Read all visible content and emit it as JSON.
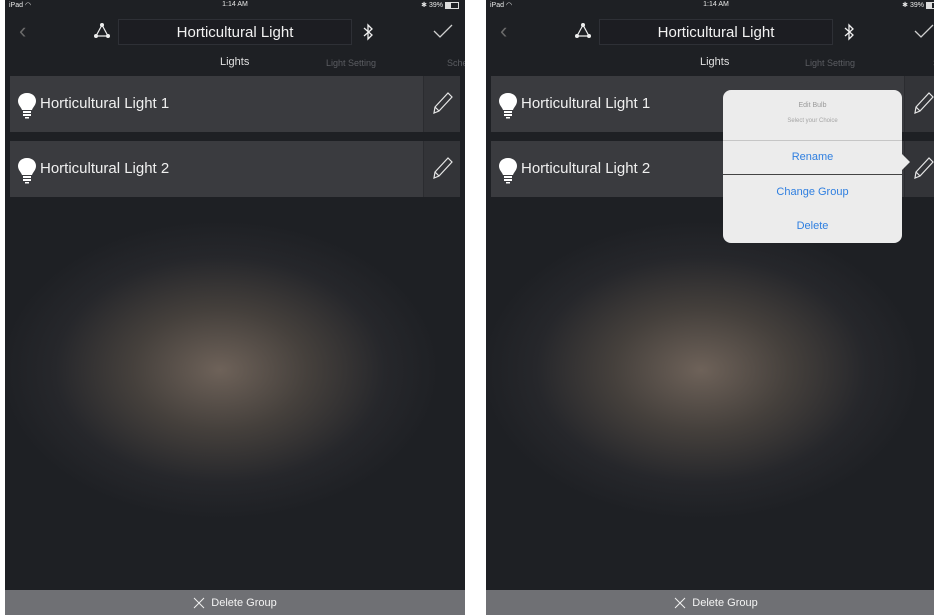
{
  "status": {
    "device": "iPad",
    "time": "1:14 AM",
    "battery": "39%"
  },
  "header": {
    "title": "Horticultural Light"
  },
  "tabs": {
    "lights": "Lights",
    "light_setting": "Light Setting",
    "schedule_left": "Sche",
    "schedule_right": "S"
  },
  "lights": [
    {
      "label": "Horticultural Light 1"
    },
    {
      "label": "Horticultural Light 2"
    }
  ],
  "footer": {
    "delete_group": "Delete Group"
  },
  "popover": {
    "title": "Edit Bulb",
    "subtitle": "Select your Choice",
    "options": [
      "Rename",
      "Change Group",
      "Delete"
    ]
  },
  "colors": {
    "link_blue": "#2f7fe0",
    "row_bg": "#3a3b3f",
    "footer_bg": "#6f7074"
  },
  "icons": [
    "back-chevron-icon",
    "group-icon",
    "bluetooth-icon",
    "checkmark-icon",
    "bulb-icon",
    "pencil-icon",
    "wifi-icon",
    "close-x-icon"
  ]
}
